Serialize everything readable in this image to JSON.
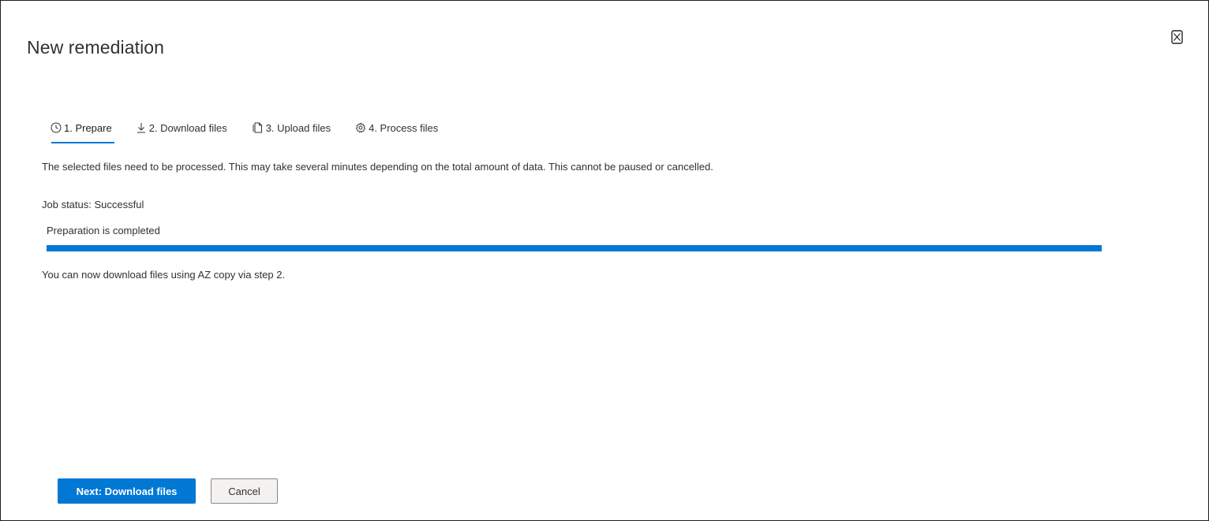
{
  "dialog": {
    "title": "New remediation",
    "close_icon": "close-icon"
  },
  "tabs": [
    {
      "label": "1. Prepare",
      "icon": "clock-icon",
      "active": true
    },
    {
      "label": "2. Download files",
      "icon": "download-icon",
      "active": false
    },
    {
      "label": "3. Upload files",
      "icon": "document-icon",
      "active": false
    },
    {
      "label": "4. Process files",
      "icon": "gear-icon",
      "active": false
    }
  ],
  "content": {
    "description": "The selected files need to be processed. This may take several minutes depending on the total amount of data. This cannot be paused or cancelled.",
    "job_status": "Job status: Successful",
    "progress_label": "Preparation is completed",
    "progress_percent": 100,
    "note": "You can now download files using AZ copy via step 2."
  },
  "footer": {
    "primary_label": "Next: Download files",
    "secondary_label": "Cancel"
  },
  "colors": {
    "accent": "#0078d4",
    "text": "#323130",
    "border": "#1f1f1f"
  }
}
